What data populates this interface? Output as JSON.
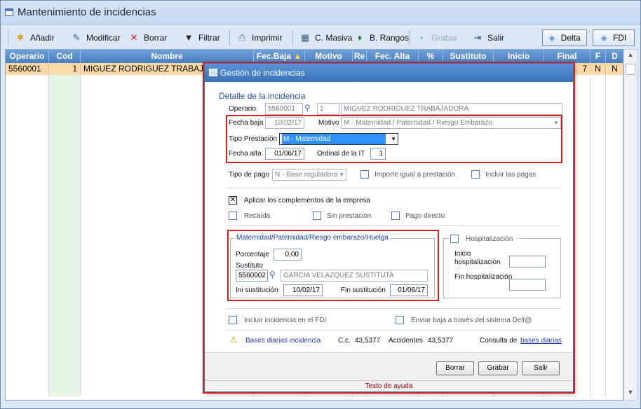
{
  "window": {
    "title": "Mantenimiento de incidencias"
  },
  "toolbar": {
    "add": "Añadir",
    "edit": "Modificar",
    "delete": "Borrar",
    "filter": "Filtrar",
    "print": "Imprimir",
    "cmasiva": "C. Masiva",
    "brangos": "B. Rangos",
    "save": "Grabar",
    "exit": "Salir",
    "delta": "Delta",
    "fdi": "FDI"
  },
  "grid": {
    "columns": [
      "Operario",
      "Cod",
      "Nombre",
      "Fec.Baja",
      "Motivo",
      "Re",
      "Fec. Alta",
      "%",
      "Sustituto",
      "Inicio",
      "Final",
      "F",
      "D"
    ],
    "row": {
      "operario": "5560001",
      "cod": "1",
      "nombre": "MIGUEZ RODRIGUEZ TRABAJAD",
      "final": "7",
      "f": "N",
      "d": "N"
    }
  },
  "dialog": {
    "title": "Gestión de incidencias",
    "section_title": "Detalle de la incidencia",
    "operario_label": "Operario",
    "operario_code": "5560001",
    "operario_num": "1",
    "operario_name": "MIGUEZ  RODRIGUEZ TRABAJADORA",
    "fecha_baja_label": "Fecha baja",
    "fecha_baja": "10/02/17",
    "motivo_label": "Motivo",
    "motivo": "M - Maternidad / Paternidad / Riesgo Embarazo",
    "tipo_prestacion_label": "Tipo Prestación",
    "tipo_prestacion": "M - Maternidad",
    "fecha_alta_label": "Fecha alta",
    "fecha_alta": "01/06/17",
    "ordinal_label": "Ordinal de la IT",
    "ordinal": "1",
    "tipo_pago_label": "Tipo de pago",
    "tipo_pago": "N - Base reguladora",
    "importe_igual_label": "Importe igual a prestación",
    "incluir_pagas_label": "Incluir las pagas",
    "aplicar_label": "Aplicar los complementos de la empresa",
    "recaida_label": "Recaída",
    "sin_prestacion_label": "Sin prestación",
    "pago_directo_label": "Pago directo",
    "group_title": "Maternidad/Paternidad/Riesgo embarazo/Huelga",
    "porcentaje_label": "Porcentaje",
    "porcentaje": "0,00",
    "sustituto_label": "Sustituto",
    "sustituto_code": "5560002",
    "sustituto_name": "GARCIA   VELAZQUEZ SUSTITUTA",
    "ini_sust_label": "Ini sustitución",
    "ini_sust": "10/02/17",
    "fin_sust_label": "Fin sustitución",
    "fin_sust": "01/06/17",
    "hosp_label": "Hospitalización",
    "inicio_hosp_label_1": "Inicio",
    "inicio_hosp_label_2": "hospitalización",
    "fin_hosp_label": "Fin hospitalización",
    "fdi_label": "Incluir incidencia en el FDI",
    "delta_label": "Enviar baja a través del sistema Delt@",
    "bases_label": "Bases diarias incidencia",
    "cc_label": "C.c.",
    "cc_value": "43,5377",
    "accidentes_label": "Accidentes",
    "accidentes_value": "43,5377",
    "consulta_label": "Consulta de",
    "consulta_link": "bases diarias",
    "btn_borrar": "Borrar",
    "btn_grabar": "Grabar",
    "btn_salir": "Salir",
    "help": "Texto de ayuda"
  }
}
